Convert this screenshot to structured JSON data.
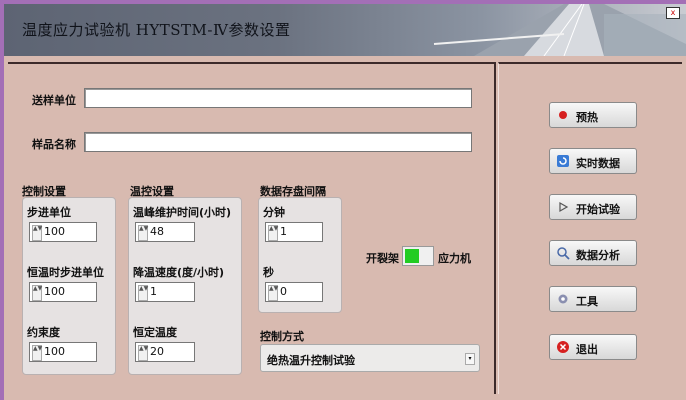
{
  "window": {
    "title": "温度应力试验机 HYTSTM-Ⅳ参数设置",
    "close_label": "x"
  },
  "form": {
    "sender_label": "送样单位",
    "sender_value": "",
    "sample_label": "样品名称",
    "sample_value": ""
  },
  "control_settings": {
    "title": "控制设置",
    "step_unit_label": "步进单位",
    "step_unit_value": "100",
    "const_temp_step_label": "恒温时步进单位",
    "const_temp_step_value": "100",
    "restraint_label": "约束度",
    "restraint_value": "100"
  },
  "temp_control": {
    "title": "温控设置",
    "peak_hold_label": "温峰维护时间(小时)",
    "peak_hold_value": "48",
    "cooling_rate_label": "降温速度(度/小时)",
    "cooling_rate_value": "1",
    "const_temp_label": "恒定温度",
    "const_temp_value": "20"
  },
  "data_interval": {
    "title": "数据存盘间隔",
    "minutes_label": "分钟",
    "minutes_value": "1",
    "seconds_label": "秒",
    "seconds_value": "0"
  },
  "switch": {
    "left_label": "开裂架",
    "right_label": "应力机"
  },
  "control_mode": {
    "label": "控制方式",
    "value": "绝热温升控制试验"
  },
  "buttons": {
    "preheat": "预热",
    "realtime": "实时数据",
    "start": "开始试验",
    "analysis": "数据分析",
    "tools": "工具",
    "exit": "退出"
  },
  "colors": {
    "background": "#d8bab0",
    "frame": "#a36fb6",
    "switch_green": "#22cc22",
    "exit_red": "#d62020"
  }
}
